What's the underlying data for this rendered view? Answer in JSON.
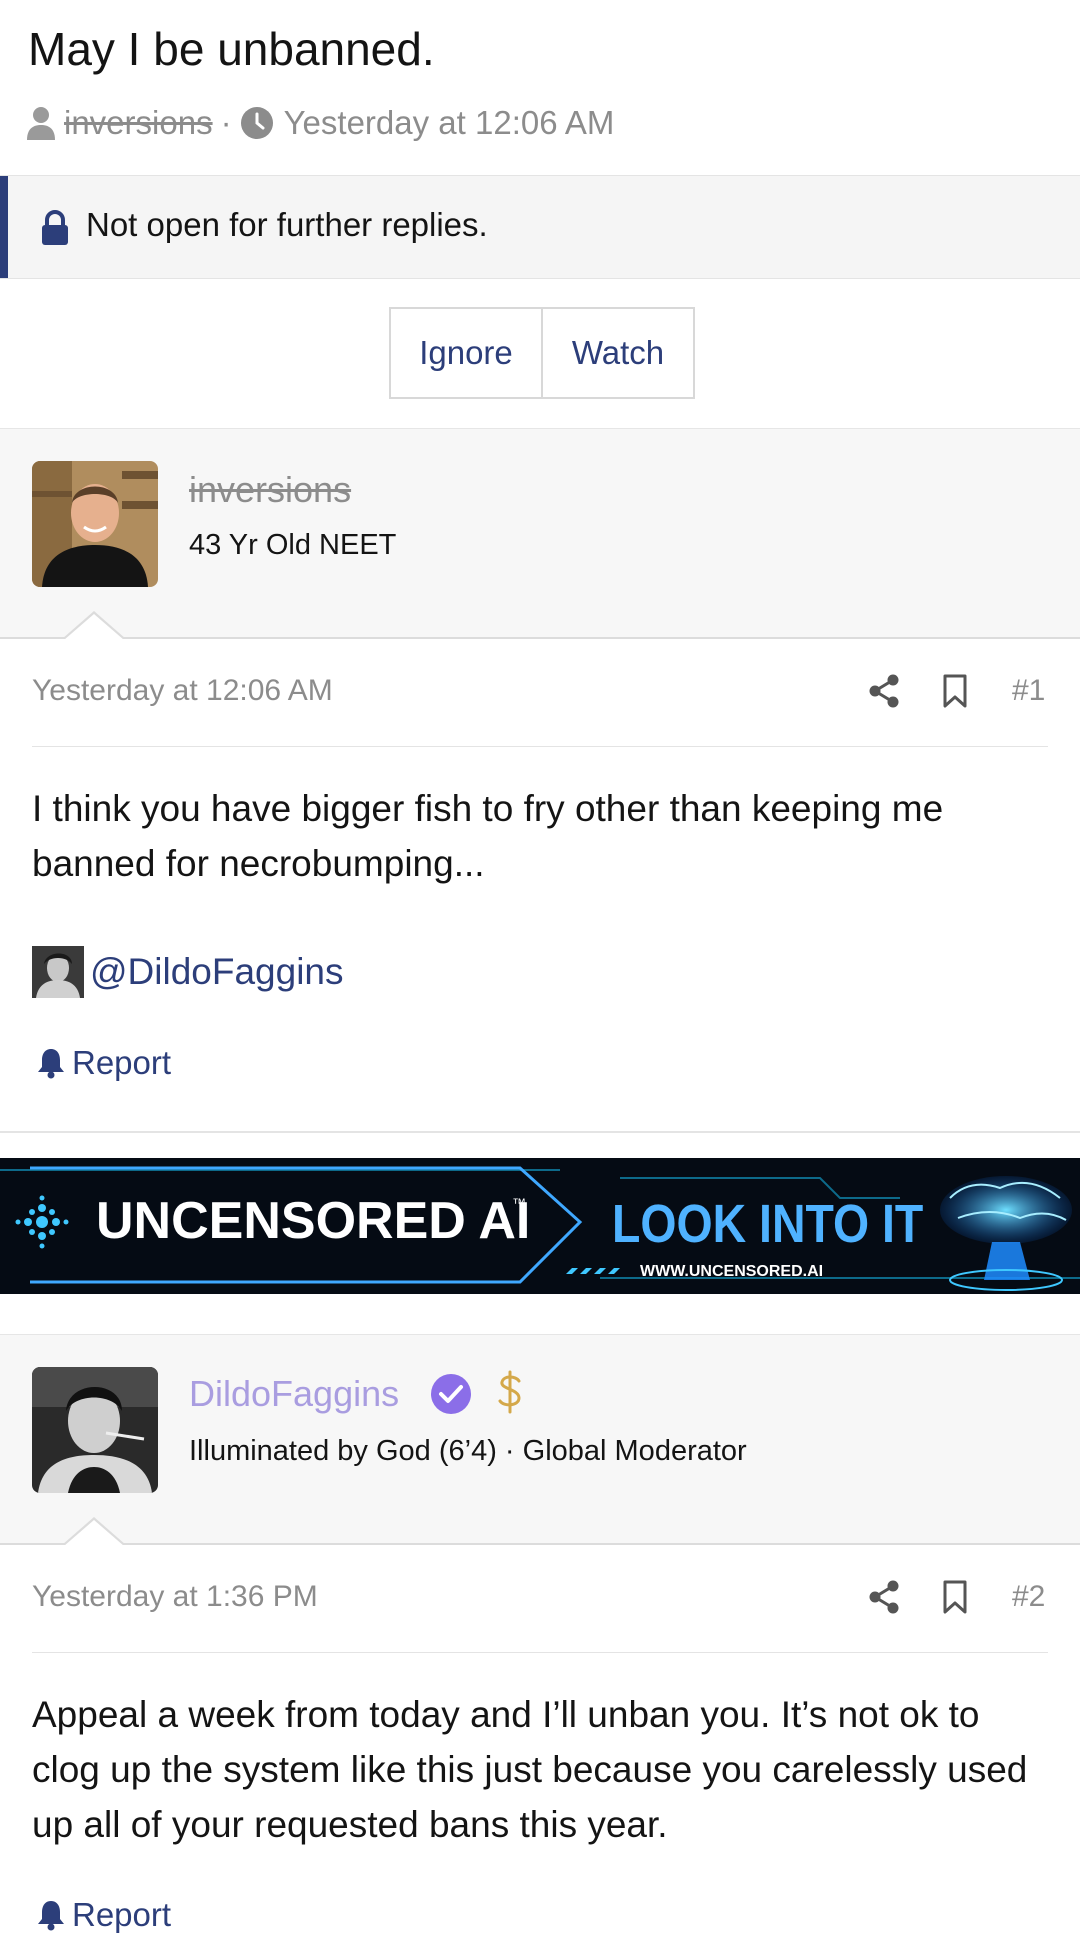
{
  "thread": {
    "title": "May I be unbanned.",
    "author": "inversions",
    "separator": "·",
    "date": "Yesterday at 12:06 AM"
  },
  "notice": {
    "text": "Not open for further replies."
  },
  "actions": {
    "ignore_label": "Ignore",
    "watch_label": "Watch"
  },
  "posts": [
    {
      "username": "inversions",
      "user_title": "43 Yr Old NEET",
      "date": "Yesterday at 12:06 AM",
      "number": "#1",
      "body": "I think you have bigger fish to fry other than keeping me banned for necrobumping...",
      "mention": "@DildoFaggins",
      "report_label": "Report"
    },
    {
      "username": "DildoFaggins",
      "user_title": "Illuminated by God (6’4) · Global Moderator",
      "date": "Yesterday at 1:36 PM",
      "number": "#2",
      "body": "Appeal a week from today and I’ll unban you. It’s not ok to clog up the system like this just because you carelessly used up all of your requested bans this year.",
      "report_label": "Report"
    }
  ],
  "ad": {
    "brand": "UNCENSORED AI",
    "tm": "™",
    "cta": "LOOK INTO IT",
    "url": "WWW.UNCENSORED.AI"
  },
  "colors": {
    "accent": "#2c3e7a",
    "muted": "#8c8c8c",
    "moderator_name": "#a99de0",
    "verified": "#8b6ee8",
    "ad_cyan": "#3fc8ff"
  },
  "icons": [
    "user-icon",
    "clock-icon",
    "lock-icon",
    "share-icon",
    "bookmark-icon",
    "bell-icon",
    "verified-icon",
    "dollar-icon"
  ]
}
